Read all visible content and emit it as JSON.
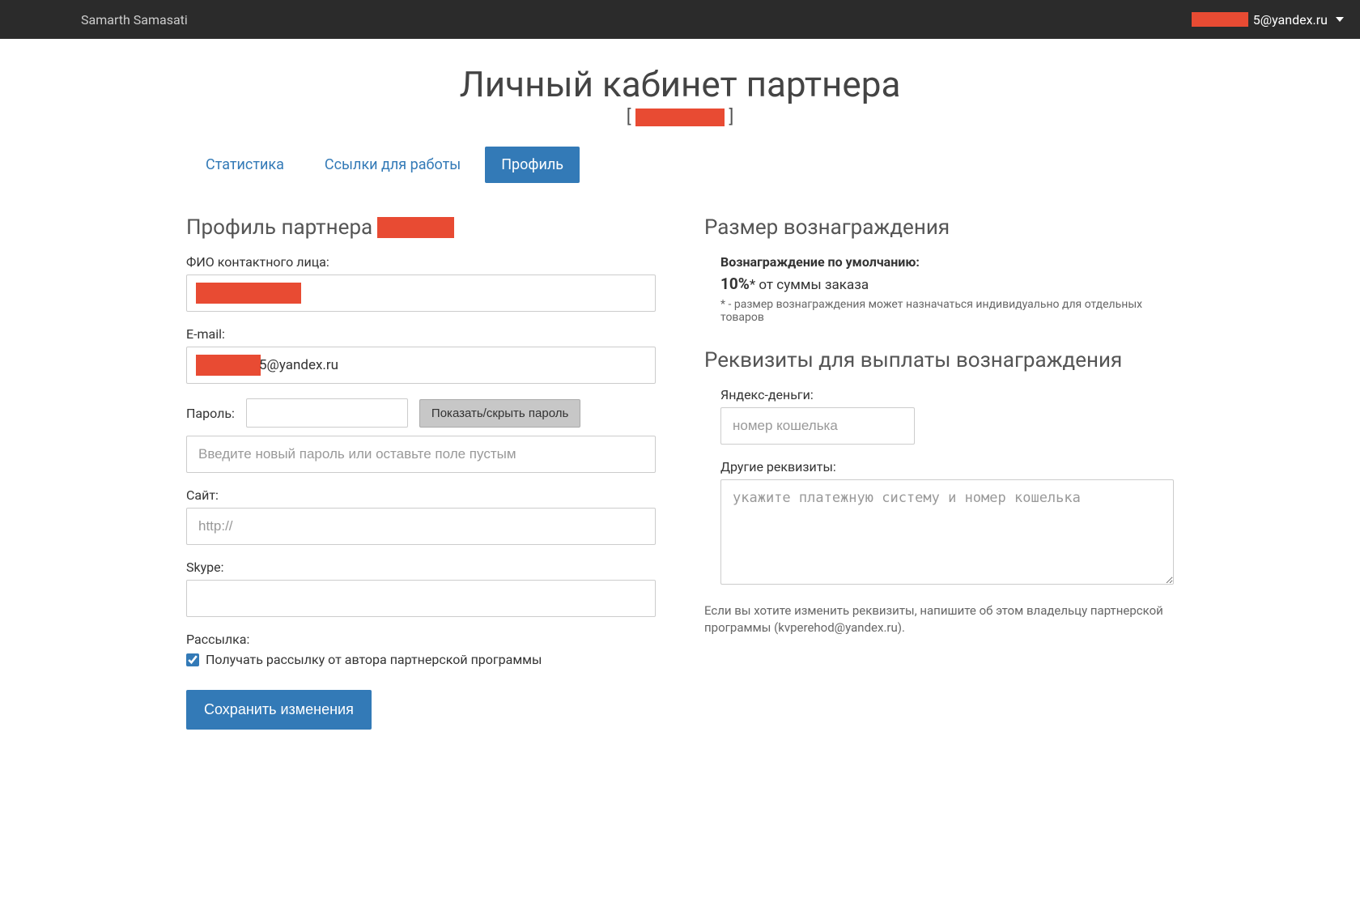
{
  "topbar": {
    "brand": "Samarth Samasati",
    "user_suffix": "5@yandex.ru"
  },
  "page": {
    "title": "Личный кабинет партнера",
    "sub_open": "[ ",
    "sub_close": " ]"
  },
  "tabs": [
    {
      "label": "Статистика",
      "active": false
    },
    {
      "label": "Ссылки для работы",
      "active": false
    },
    {
      "label": "Профиль",
      "active": true
    }
  ],
  "profile": {
    "heading_prefix": "Профиль партнера ",
    "fio_label": "ФИО контактного лица:",
    "fio_value": "",
    "email_label": "E-mail:",
    "email_suffix": "5@yandex.ru",
    "password_label": "Пароль:",
    "toggle_password": "Показать/скрыть пароль",
    "password_placeholder": "Введите новый пароль или оставьте поле пустым",
    "site_label": "Сайт:",
    "site_placeholder": "http://",
    "skype_label": "Skype:",
    "mailing_label": "Рассылка:",
    "mailing_checkbox": "Получать рассылку от автора партнерской программы",
    "save_button": "Сохранить изменения"
  },
  "reward": {
    "heading": "Размер вознаграждения",
    "default_label": "Вознаграждение по умолчанию:",
    "value_percent": "10%",
    "value_suffix": "* от суммы заказа",
    "note": "* - размер вознаграждения может назначаться индивидуально для отдельных товаров"
  },
  "payout": {
    "heading": "Реквизиты для выплаты вознаграждения",
    "yandex_label": "Яндекс-деньги:",
    "yandex_placeholder": "номер кошелька",
    "other_label": "Другие реквизиты:",
    "other_placeholder": "укажите платежную систему и номер кошелька",
    "footer": "Если вы хотите изменить реквизиты, напишите об этом владельцу партнерской программы (kvperehod@yandex.ru)."
  }
}
